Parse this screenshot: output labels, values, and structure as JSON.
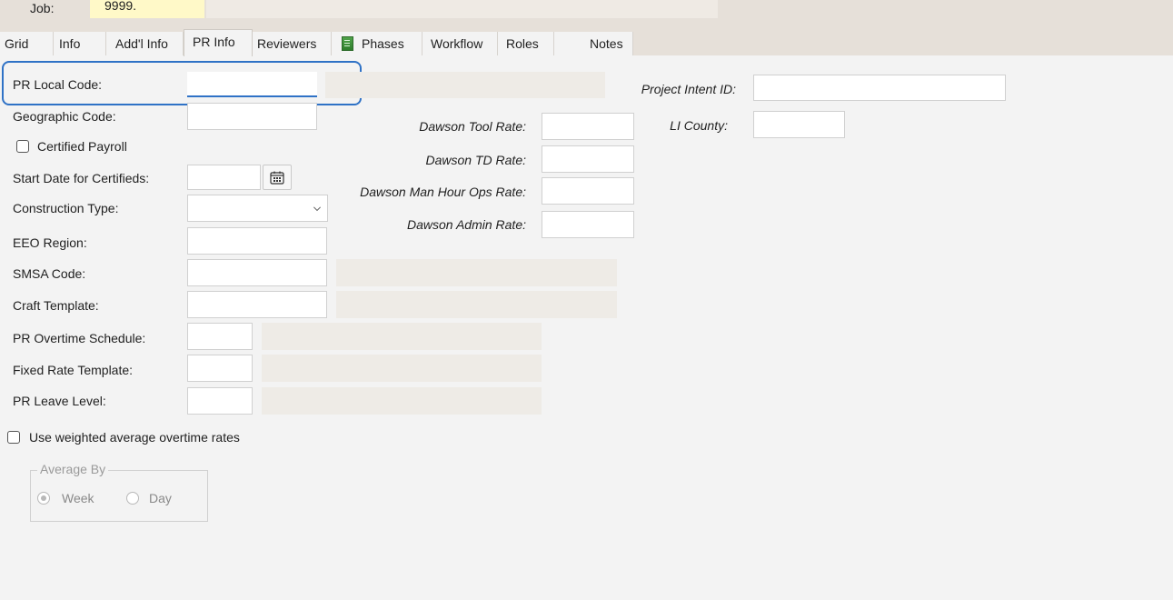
{
  "header": {
    "job_label": "Job:",
    "job_value": "9999."
  },
  "tabs": [
    {
      "label": "Grid"
    },
    {
      "label": "Info"
    },
    {
      "label": "Add'l Info"
    },
    {
      "label": "PR Info",
      "active": true
    },
    {
      "label": "Reviewers"
    },
    {
      "label": "Phases",
      "icon": "phases-icon"
    },
    {
      "label": "Workflow"
    },
    {
      "label": "Roles"
    },
    {
      "label": "Notes"
    }
  ],
  "form": {
    "pr_local_code": {
      "label": "PR Local Code:",
      "value": ""
    },
    "geographic_code": {
      "label": "Geographic Code:",
      "value": ""
    },
    "certified_payroll": {
      "label": "Certified Payroll",
      "checked": false
    },
    "start_date_certifieds": {
      "label": "Start Date for Certifieds:",
      "value": ""
    },
    "construction_type": {
      "label": "Construction Type:",
      "value": ""
    },
    "eeo_region": {
      "label": "EEO Region:",
      "value": ""
    },
    "smsa_code": {
      "label": "SMSA Code:",
      "value": ""
    },
    "craft_template": {
      "label": "Craft Template:",
      "value": ""
    },
    "pr_overtime_schedule": {
      "label": "PR Overtime Schedule:",
      "value": ""
    },
    "fixed_rate_template": {
      "label": "Fixed Rate Template:",
      "value": ""
    },
    "pr_leave_level": {
      "label": "PR Leave Level:",
      "value": ""
    },
    "dawson_tool_rate": {
      "label": "Dawson Tool Rate:",
      "value": ""
    },
    "dawson_td_rate": {
      "label": "Dawson TD Rate:",
      "value": ""
    },
    "dawson_man_hour_ops_rate": {
      "label": "Dawson Man Hour Ops Rate:",
      "value": ""
    },
    "dawson_admin_rate": {
      "label": "Dawson Admin Rate:",
      "value": ""
    },
    "project_intent_id": {
      "label": "Project Intent ID:",
      "value": ""
    },
    "li_county": {
      "label": "LI County:",
      "value": ""
    },
    "use_weighted_avg": {
      "label": "Use weighted average overtime rates",
      "checked": false
    },
    "average_by": {
      "title": "Average By",
      "options": [
        {
          "label": "Week",
          "selected": true
        },
        {
          "label": "Day",
          "selected": false
        }
      ]
    }
  },
  "colors": {
    "accent": "#2f72c6",
    "job_field_bg": "#fff9c8",
    "header_bg": "#e6e0d9"
  }
}
